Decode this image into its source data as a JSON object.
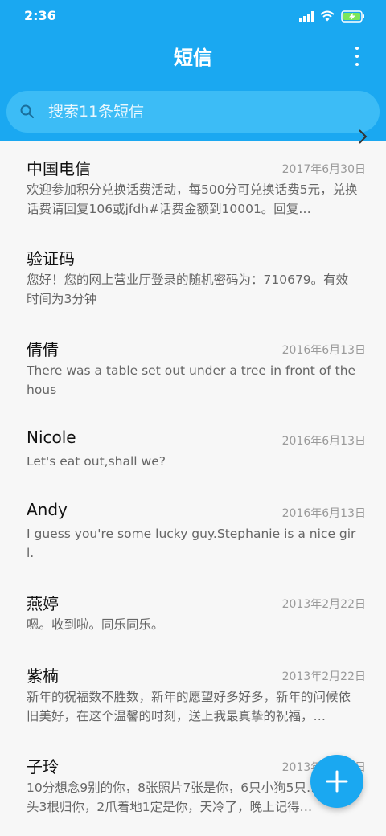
{
  "status_bar": {
    "time": "2:36",
    "icons": [
      "signal-icon",
      "wifi-icon",
      "battery-charging-icon"
    ]
  },
  "header": {
    "title": "短信",
    "more_icon": "more-vertical-icon"
  },
  "search": {
    "placeholder": "搜索11条短信",
    "icon": "search-icon"
  },
  "messages": [
    {
      "name": "中国电信",
      "date": "2017年6月30日",
      "preview": "欢迎参加积分兑换话费活动，每500分可兑换话费5元，兑换话费请回复106或jfdh#话费金额到10001。回复…"
    },
    {
      "name": "验证码",
      "date": "",
      "preview": "您好！您的网上营业厅登录的随机密码为：710679。有效时间为3分钟"
    },
    {
      "name": "倩倩",
      "date": "2016年6月13日",
      "preview": "There was a table set out under a tree in front of the hous"
    },
    {
      "name": "Nicole",
      "date": "2016年6月13日",
      "preview": "Let's eat out,shall we?"
    },
    {
      "name": "Andy",
      "date": "2016年6月13日",
      "preview": "I guess you're some lucky guy.Stephanie is a nice girl."
    },
    {
      "name": "燕婷",
      "date": "2013年2月22日",
      "preview": "嗯。收到啦。同乐同乐。"
    },
    {
      "name": "紫楠",
      "date": "2013年2月22日",
      "preview": "新年的祝福数不胜数，新年的愿望好多好多，新年的问候依旧美好，在这个温馨的时刻，送上我最真挚的祝福，…"
    },
    {
      "name": "子玲",
      "date": "2013年2月22日",
      "preview": "10分想念9别的你，8张照片7张是你，6只小狗5只…4根骨头3根归你，2爪着地1定是你，天冷了，晚上记得…"
    }
  ],
  "fab": {
    "icon": "plus-icon"
  },
  "colors": {
    "accent": "#1aa8f1",
    "search_bg": "#3cbcf6",
    "background": "#f7f7f7"
  }
}
